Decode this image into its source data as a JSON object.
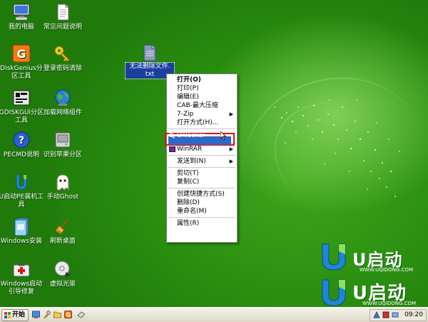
{
  "desktop_icons": [
    {
      "label": "我的电脑"
    },
    {
      "label": "常见问题说明"
    },
    {
      "label": "DiskGenius分区工具"
    },
    {
      "label": "登录密码清除"
    },
    {
      "label": "GDISKGUI分区工具"
    },
    {
      "label": "加载网络组件"
    },
    {
      "label": "PECMD说明"
    },
    {
      "label": "识别苹果分区"
    },
    {
      "label": "U启动PE装机工具"
    },
    {
      "label": "手动Ghost"
    },
    {
      "label": "Windows安装"
    },
    {
      "label": "刷新桌面"
    },
    {
      "label": "Windows启动引导修复"
    },
    {
      "label": "虚拟光驱"
    }
  ],
  "selected_file": {
    "label_line1": "无法删除文件.",
    "label_line2": "txt"
  },
  "context_menu": {
    "items": [
      {
        "label": "打开(O)"
      },
      {
        "label": "打印(P)"
      },
      {
        "label": "编辑(E)"
      },
      {
        "label": "CAB-最大压缩"
      },
      {
        "label": "7-Zip"
      },
      {
        "label": "打开方式(H)..."
      },
      {
        "label": "Unlocker"
      },
      {
        "label": "WinRAR"
      },
      {
        "label": "发送到(N)"
      },
      {
        "label": "剪切(T)"
      },
      {
        "label": "复制(C)"
      },
      {
        "label": "创建快捷方式(S)"
      },
      {
        "label": "删除(D)"
      },
      {
        "label": "重命名(M)"
      },
      {
        "label": "属性(R)"
      }
    ]
  },
  "taskbar": {
    "start_label": "开始",
    "clock": "09:20"
  },
  "brand": {
    "logo_text": "U启动",
    "url": "WWW.UQIDONG.COM"
  },
  "colors": {
    "desktop_green": "#2a8f10",
    "selection_blue": "#1c3f9e",
    "highlight_red": "#e01010"
  }
}
